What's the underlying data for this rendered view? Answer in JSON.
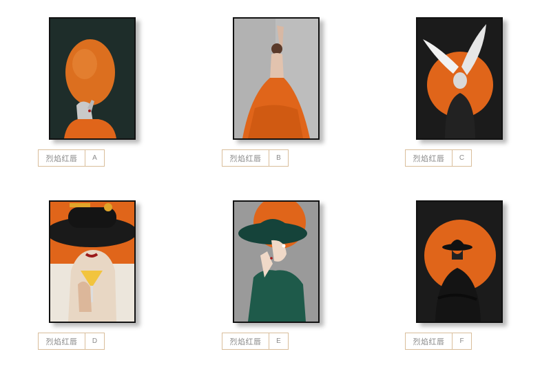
{
  "products": [
    {
      "name": "烈焰红唇",
      "variant": "A",
      "image_icon": "orange-balloon-woman-painting-icon"
    },
    {
      "name": "烈焰红唇",
      "variant": "B",
      "image_icon": "ballerina-orange-dress-painting-icon"
    },
    {
      "name": "烈焰红唇",
      "variant": "C",
      "image_icon": "winged-figure-orange-sun-painting-icon"
    },
    {
      "name": "烈焰红唇",
      "variant": "D",
      "image_icon": "black-hat-cocktail-woman-painting-icon"
    },
    {
      "name": "烈焰红唇",
      "variant": "E",
      "image_icon": "green-hat-woman-painting-icon"
    },
    {
      "name": "烈焰红唇",
      "variant": "F",
      "image_icon": "black-hat-orange-sun-painting-icon"
    }
  ],
  "colors": {
    "orange": "#e0651a",
    "dark_green": "#1e2d2a",
    "black": "#111111",
    "label_border": "#d9bd9a",
    "label_text": "#8a8a8a"
  }
}
